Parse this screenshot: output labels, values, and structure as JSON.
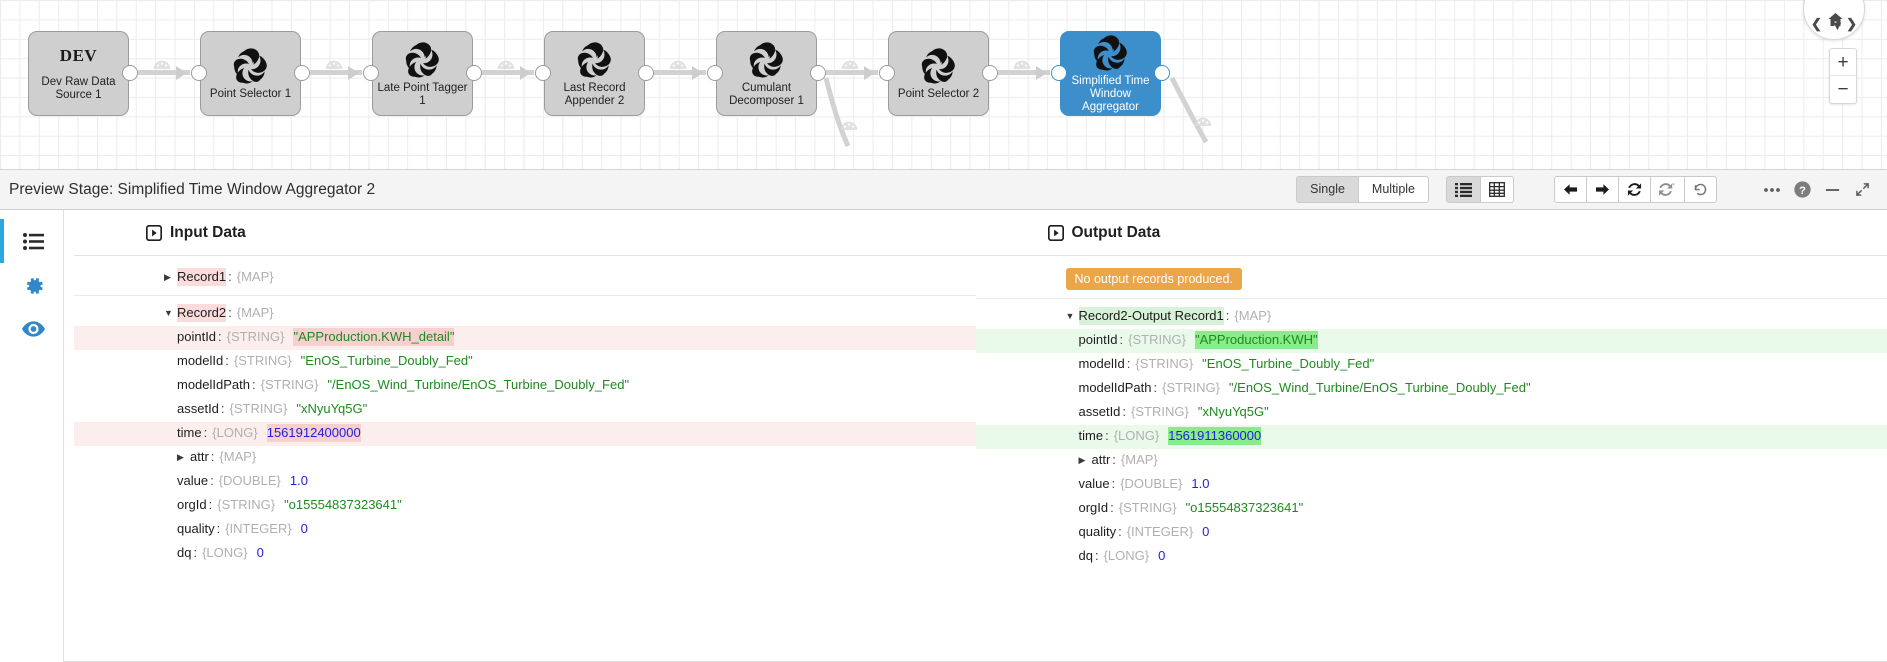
{
  "canvas": {
    "nodes": [
      {
        "name": "dev-raw-data-source-1",
        "title": "Dev Raw Data\nSource 1",
        "label_line1": "Dev Raw Data",
        "label_line2": "Source 1",
        "badge": "DEV",
        "selected": false
      },
      {
        "name": "point-selector-1",
        "label_line1": "Point Selector 1",
        "label_line2": "",
        "badge": "",
        "selected": false
      },
      {
        "name": "late-point-tagger-1",
        "label_line1": "Late Point Tagger 1",
        "label_line2": "",
        "badge": "",
        "selected": false
      },
      {
        "name": "last-record-appender-2",
        "label_line1": "Last Record",
        "label_line2": "Appender 2",
        "badge": "",
        "selected": false
      },
      {
        "name": "cumulant-decomposer-1",
        "label_line1": "Cumulant",
        "label_line2": "Decomposer 1",
        "badge": "",
        "selected": false
      },
      {
        "name": "point-selector-2",
        "label_line1": "Point Selector 2",
        "label_line2": "",
        "badge": "",
        "selected": false
      },
      {
        "name": "simplified-time-window-aggregator",
        "label_line1": "Simplified Time",
        "label_line2": "Window Aggregator",
        "badge": "",
        "selected": true
      }
    ],
    "selected_color": "#3d8fcc",
    "zoom_in": "+",
    "zoom_out": "−"
  },
  "toolbar": {
    "title": "Preview Stage: Simplified Time Window Aggregator 2",
    "single_label": "Single",
    "multiple_label": "Multiple",
    "single_active": true,
    "icons": {
      "list_view": "list-view-icon",
      "table_view": "table-view-icon",
      "step_back": "arrow-left-icon",
      "step_forward": "arrow-right-icon",
      "refresh": "refresh-icon",
      "refresh_all": "refresh-all-icon",
      "revert": "revert-icon",
      "more": "ellipsis-icon",
      "help": "help-icon",
      "minimize": "minimize-icon",
      "expand": "expand-icon"
    }
  },
  "rail": {
    "items": [
      {
        "name": "sidebar-item-records",
        "icon": "list-icon",
        "active": true
      },
      {
        "name": "sidebar-item-settings",
        "icon": "gear-icon",
        "active": false
      },
      {
        "name": "sidebar-item-preview",
        "icon": "eye-icon",
        "active": false
      }
    ]
  },
  "input_pane": {
    "heading": "Input Data",
    "icon": "play-box-icon",
    "record1": {
      "key": "Record1",
      "type": "{MAP}",
      "expanded": false
    },
    "record2": {
      "key": "Record2",
      "type": "{MAP}",
      "expanded": true
    },
    "fields": [
      {
        "key": "pointId",
        "type": "{STRING}",
        "value": "\"APProduction.KWH_detail\"",
        "value_kind": "str",
        "row_highlight": "pink",
        "value_mark": "pink"
      },
      {
        "key": "modelId",
        "type": "{STRING}",
        "value": "\"EnOS_Turbine_Doubly_Fed\"",
        "value_kind": "str",
        "row_highlight": "none",
        "value_mark": "none"
      },
      {
        "key": "modelIdPath",
        "type": "{STRING}",
        "value": "\"/EnOS_Wind_Turbine/EnOS_Turbine_Doubly_Fed\"",
        "value_kind": "str",
        "row_highlight": "none",
        "value_mark": "none"
      },
      {
        "key": "assetId",
        "type": "{STRING}",
        "value": "\"xNyuYq5G\"",
        "value_kind": "str",
        "row_highlight": "none",
        "value_mark": "none"
      },
      {
        "key": "time",
        "type": "{LONG}",
        "value": "1561912400000",
        "value_kind": "num",
        "row_highlight": "pink",
        "value_mark": "pink"
      },
      {
        "key": "attr",
        "type": "{MAP}",
        "value": "",
        "value_kind": "none",
        "row_highlight": "none",
        "value_mark": "none",
        "caret": "▶"
      },
      {
        "key": "value",
        "type": "{DOUBLE}",
        "value": "1.0",
        "value_kind": "num",
        "row_highlight": "none",
        "value_mark": "none"
      },
      {
        "key": "orgId",
        "type": "{STRING}",
        "value": "\"o15554837323641\"",
        "value_kind": "str",
        "row_highlight": "none",
        "value_mark": "none"
      },
      {
        "key": "quality",
        "type": "{INTEGER}",
        "value": "0",
        "value_kind": "num",
        "row_highlight": "none",
        "value_mark": "none"
      },
      {
        "key": "dq",
        "type": "{LONG}",
        "value": "0",
        "value_kind": "num",
        "row_highlight": "none",
        "value_mark": "none"
      }
    ]
  },
  "output_pane": {
    "heading": "Output Data",
    "icon": "play-box-icon",
    "no_output_message": "No output records produced.",
    "no_output_color": "#eca64a",
    "record": {
      "key": "Record2-Output Record1",
      "type": "{MAP}",
      "expanded": true
    },
    "fields": [
      {
        "key": "pointId",
        "type": "{STRING}",
        "value": "\"APProduction.KWH\"",
        "value_kind": "str",
        "row_highlight": "green",
        "value_mark": "green"
      },
      {
        "key": "modelId",
        "type": "{STRING}",
        "value": "\"EnOS_Turbine_Doubly_Fed\"",
        "value_kind": "str",
        "row_highlight": "none",
        "value_mark": "none"
      },
      {
        "key": "modelIdPath",
        "type": "{STRING}",
        "value": "\"/EnOS_Wind_Turbine/EnOS_Turbine_Doubly_Fed\"",
        "value_kind": "str",
        "row_highlight": "none",
        "value_mark": "none"
      },
      {
        "key": "assetId",
        "type": "{STRING}",
        "value": "\"xNyuYq5G\"",
        "value_kind": "str",
        "row_highlight": "none",
        "value_mark": "none"
      },
      {
        "key": "time",
        "type": "{LONG}",
        "value": "1561911360000",
        "value_kind": "num",
        "row_highlight": "green",
        "value_mark": "green"
      },
      {
        "key": "attr",
        "type": "{MAP}",
        "value": "",
        "value_kind": "none",
        "row_highlight": "none",
        "value_mark": "none",
        "caret": "▶"
      },
      {
        "key": "value",
        "type": "{DOUBLE}",
        "value": "1.0",
        "value_kind": "num",
        "row_highlight": "none",
        "value_mark": "none"
      },
      {
        "key": "orgId",
        "type": "{STRING}",
        "value": "\"o15554837323641\"",
        "value_kind": "str",
        "row_highlight": "none",
        "value_mark": "none"
      },
      {
        "key": "quality",
        "type": "{INTEGER}",
        "value": "0",
        "value_kind": "num",
        "row_highlight": "none",
        "value_mark": "none"
      },
      {
        "key": "dq",
        "type": "{LONG}",
        "value": "0",
        "value_kind": "num",
        "row_highlight": "none",
        "value_mark": "none"
      }
    ]
  }
}
